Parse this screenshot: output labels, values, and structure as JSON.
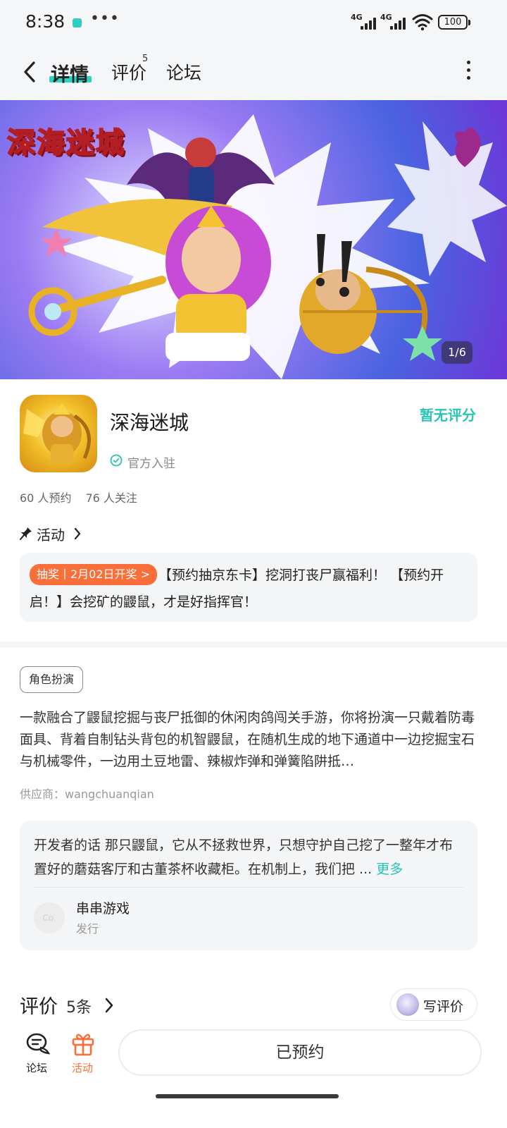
{
  "status_bar": {
    "time": "8:38",
    "network_label": "4G",
    "battery": "100",
    "more_dots": "•••"
  },
  "nav": {
    "tabs": [
      {
        "label": "详情",
        "active": true
      },
      {
        "label": "评价",
        "badge": "5"
      },
      {
        "label": "论坛"
      }
    ]
  },
  "banner": {
    "logo_text": "深海迷城",
    "counter": "1/6"
  },
  "app": {
    "title": "深海迷城",
    "official_label": "官方入驻",
    "rating_text": "暂无评分",
    "reservations": "60 人预约",
    "followers": "76 人关注"
  },
  "activity": {
    "heading": "活动",
    "tag": "抽奖丨2月02日开奖 >",
    "text": "【预约抽京东卡】挖洞打丧尸赢福利！ 【预约开启！】会挖矿的鼹鼠，才是好指挥官！"
  },
  "details": {
    "genre_tag": "角色扮演",
    "description": "一款融合了鼹鼠挖掘与丧尸抵御的休闲肉鸽闯关手游，你将扮演一只戴着防毒面具、背着自制钻头背包的机智鼹鼠，在随机生成的地下通道中一边挖掘宝石与机械零件，一边用土豆地雷、辣椒炸弹和弹簧陷阱抵…",
    "supplier": "供应商：wangchuanqian"
  },
  "developer": {
    "text": "开发者的话  那只鼹鼠，它从不拯救世界，只想守护自己挖了一整年才布置好的蘑菇客厅和古董茶杯收藏柜。在机制上，我们把 ...",
    "more_label": "更多",
    "publisher_avatar": "Co.",
    "publisher_name": "串串游戏",
    "publisher_role": "发行"
  },
  "reviews": {
    "title": "评价",
    "count": "5条",
    "write_label": "写评价"
  },
  "bottom_bar": {
    "forum_label": "论坛",
    "activity_label": "活动",
    "reserved_label": "已预约"
  },
  "colors": {
    "accent_teal": "#2bc3b4",
    "tab_underline": "#2bd5c4",
    "activity_orange": "#fa6e3a"
  },
  "icons": [
    "back-arrow-icon",
    "more-vertical-icon",
    "verified-check-icon",
    "pin-icon",
    "chevron-right-icon",
    "forum-chat-icon",
    "gift-icon",
    "wifi-icon",
    "signal-icon",
    "battery-icon"
  ]
}
